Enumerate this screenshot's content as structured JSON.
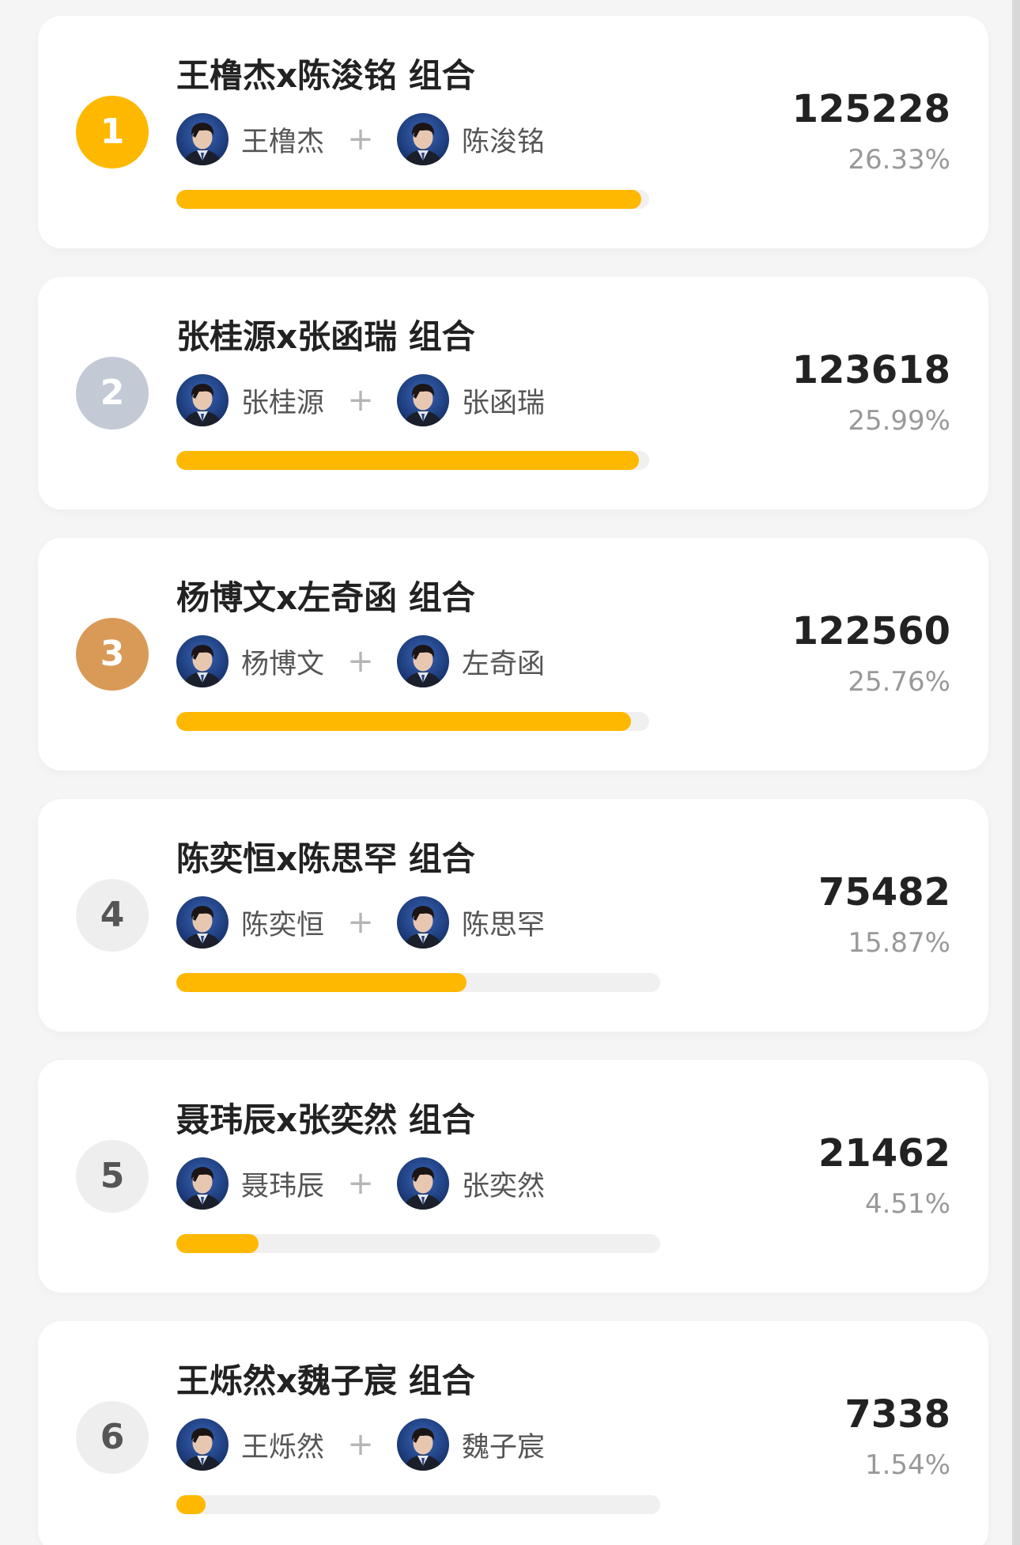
{
  "colors": {
    "accent": "#FFB800",
    "rank_1": "#FFB800",
    "rank_2": "#C3CAD6",
    "rank_3": "#D99A57",
    "rank_other": "#EEEEEE",
    "rank_other_text": "#555555",
    "track": "#F0F0F0"
  },
  "plus_symbol": "+",
  "entries": [
    {
      "rank": "1",
      "title": "王橹杰x陈浚铭 组合",
      "member_a": "王橹杰",
      "member_b": "陈浚铭",
      "votes": "125228",
      "percent": "26.33%",
      "progress": 0.9826
    },
    {
      "rank": "2",
      "title": "张桂源x张函瑞 组合",
      "member_a": "张桂源",
      "member_b": "张函瑞",
      "votes": "123618",
      "percent": "25.99%",
      "progress": 0.9782
    },
    {
      "rank": "3",
      "title": "杨博文x左奇函 组合",
      "member_a": "杨博文",
      "member_b": "左奇函",
      "votes": "122560",
      "percent": "25.76%",
      "progress": 0.9619
    },
    {
      "rank": "4",
      "title": "陈奕恒x陈思罕 组合",
      "member_a": "陈奕恒",
      "member_b": "陈思罕",
      "votes": "75482",
      "percent": "15.87%",
      "progress": 0.6
    },
    {
      "rank": "5",
      "title": "聂玮辰x张奕然 组合",
      "member_a": "聂玮辰",
      "member_b": "张奕然",
      "votes": "21462",
      "percent": "4.51%",
      "progress": 0.17
    },
    {
      "rank": "6",
      "title": "王烁然x魏子宸 组合",
      "member_a": "王烁然",
      "member_b": "魏子宸",
      "votes": "7338",
      "percent": "1.54%",
      "progress": 0.06
    }
  ]
}
